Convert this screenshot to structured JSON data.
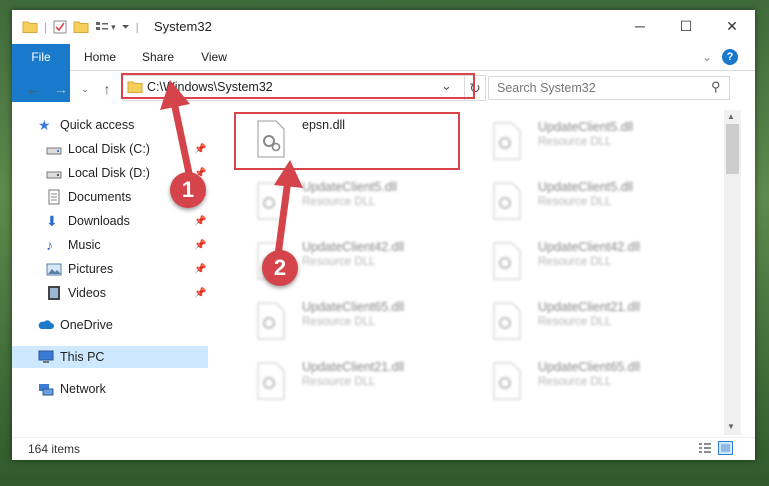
{
  "window": {
    "title": "System32",
    "minimize_glyph": "─",
    "maximize_glyph": "☐",
    "close_glyph": "✕"
  },
  "ribbon": {
    "tabs": [
      {
        "label": "File"
      },
      {
        "label": "Home"
      },
      {
        "label": "Share"
      },
      {
        "label": "View"
      }
    ],
    "collapse_glyph": "⌄",
    "help_glyph": "?"
  },
  "address_bar": {
    "path": "C:\\Windows\\System32",
    "dropdown_glyph": "⌄",
    "refresh_glyph": "↻"
  },
  "search": {
    "placeholder": "Search System32",
    "icon_glyph": "⚲"
  },
  "nav_pane": {
    "items": [
      {
        "label": "Quick access",
        "icon": "star-icon",
        "pinned": false
      },
      {
        "label": "Local Disk (C:)",
        "icon": "drive-icon",
        "pinned": true
      },
      {
        "label": "Local Disk (D:)",
        "icon": "drive-icon",
        "pinned": true
      },
      {
        "label": "Documents",
        "icon": "documents-icon",
        "pinned": true
      },
      {
        "label": "Downloads",
        "icon": "download-icon",
        "pinned": true
      },
      {
        "label": "Music",
        "icon": "music-icon",
        "pinned": true
      },
      {
        "label": "Pictures",
        "icon": "pictures-icon",
        "pinned": true
      },
      {
        "label": "Videos",
        "icon": "video-icon",
        "pinned": true
      },
      {
        "label": "OneDrive",
        "icon": "cloud-icon",
        "pinned": false
      },
      {
        "label": "This PC",
        "icon": "computer-icon",
        "pinned": false,
        "selected": true
      },
      {
        "label": "Network",
        "icon": "network-icon",
        "pinned": false
      }
    ]
  },
  "files": [
    {
      "name": "epsn.dll",
      "type": ""
    },
    {
      "name": "UpdateClient5.dll",
      "type": "Resource DLL"
    },
    {
      "name": "UpdateClient5.dll",
      "type": "Resource DLL"
    },
    {
      "name": "UpdateClient5.dll",
      "type": "Resource DLL"
    },
    {
      "name": "UpdateClient42.dll",
      "type": "Resource DLL"
    },
    {
      "name": "UpdateClient42.dll",
      "type": "Resource DLL"
    },
    {
      "name": "UpdateClient65.dll",
      "type": "Resource DLL"
    },
    {
      "name": "UpdateClient21.dll",
      "type": "Resource DLL"
    },
    {
      "name": "UpdateClient21.dll",
      "type": "Resource DLL"
    },
    {
      "name": "UpdateClient65.dll",
      "type": "Resource DLL"
    }
  ],
  "status_bar": {
    "item_count": "164 items"
  },
  "callouts": [
    "1",
    "2"
  ],
  "colors": {
    "accent": "#1979ca",
    "highlight": "#d9434a",
    "selection": "#cde8ff"
  }
}
